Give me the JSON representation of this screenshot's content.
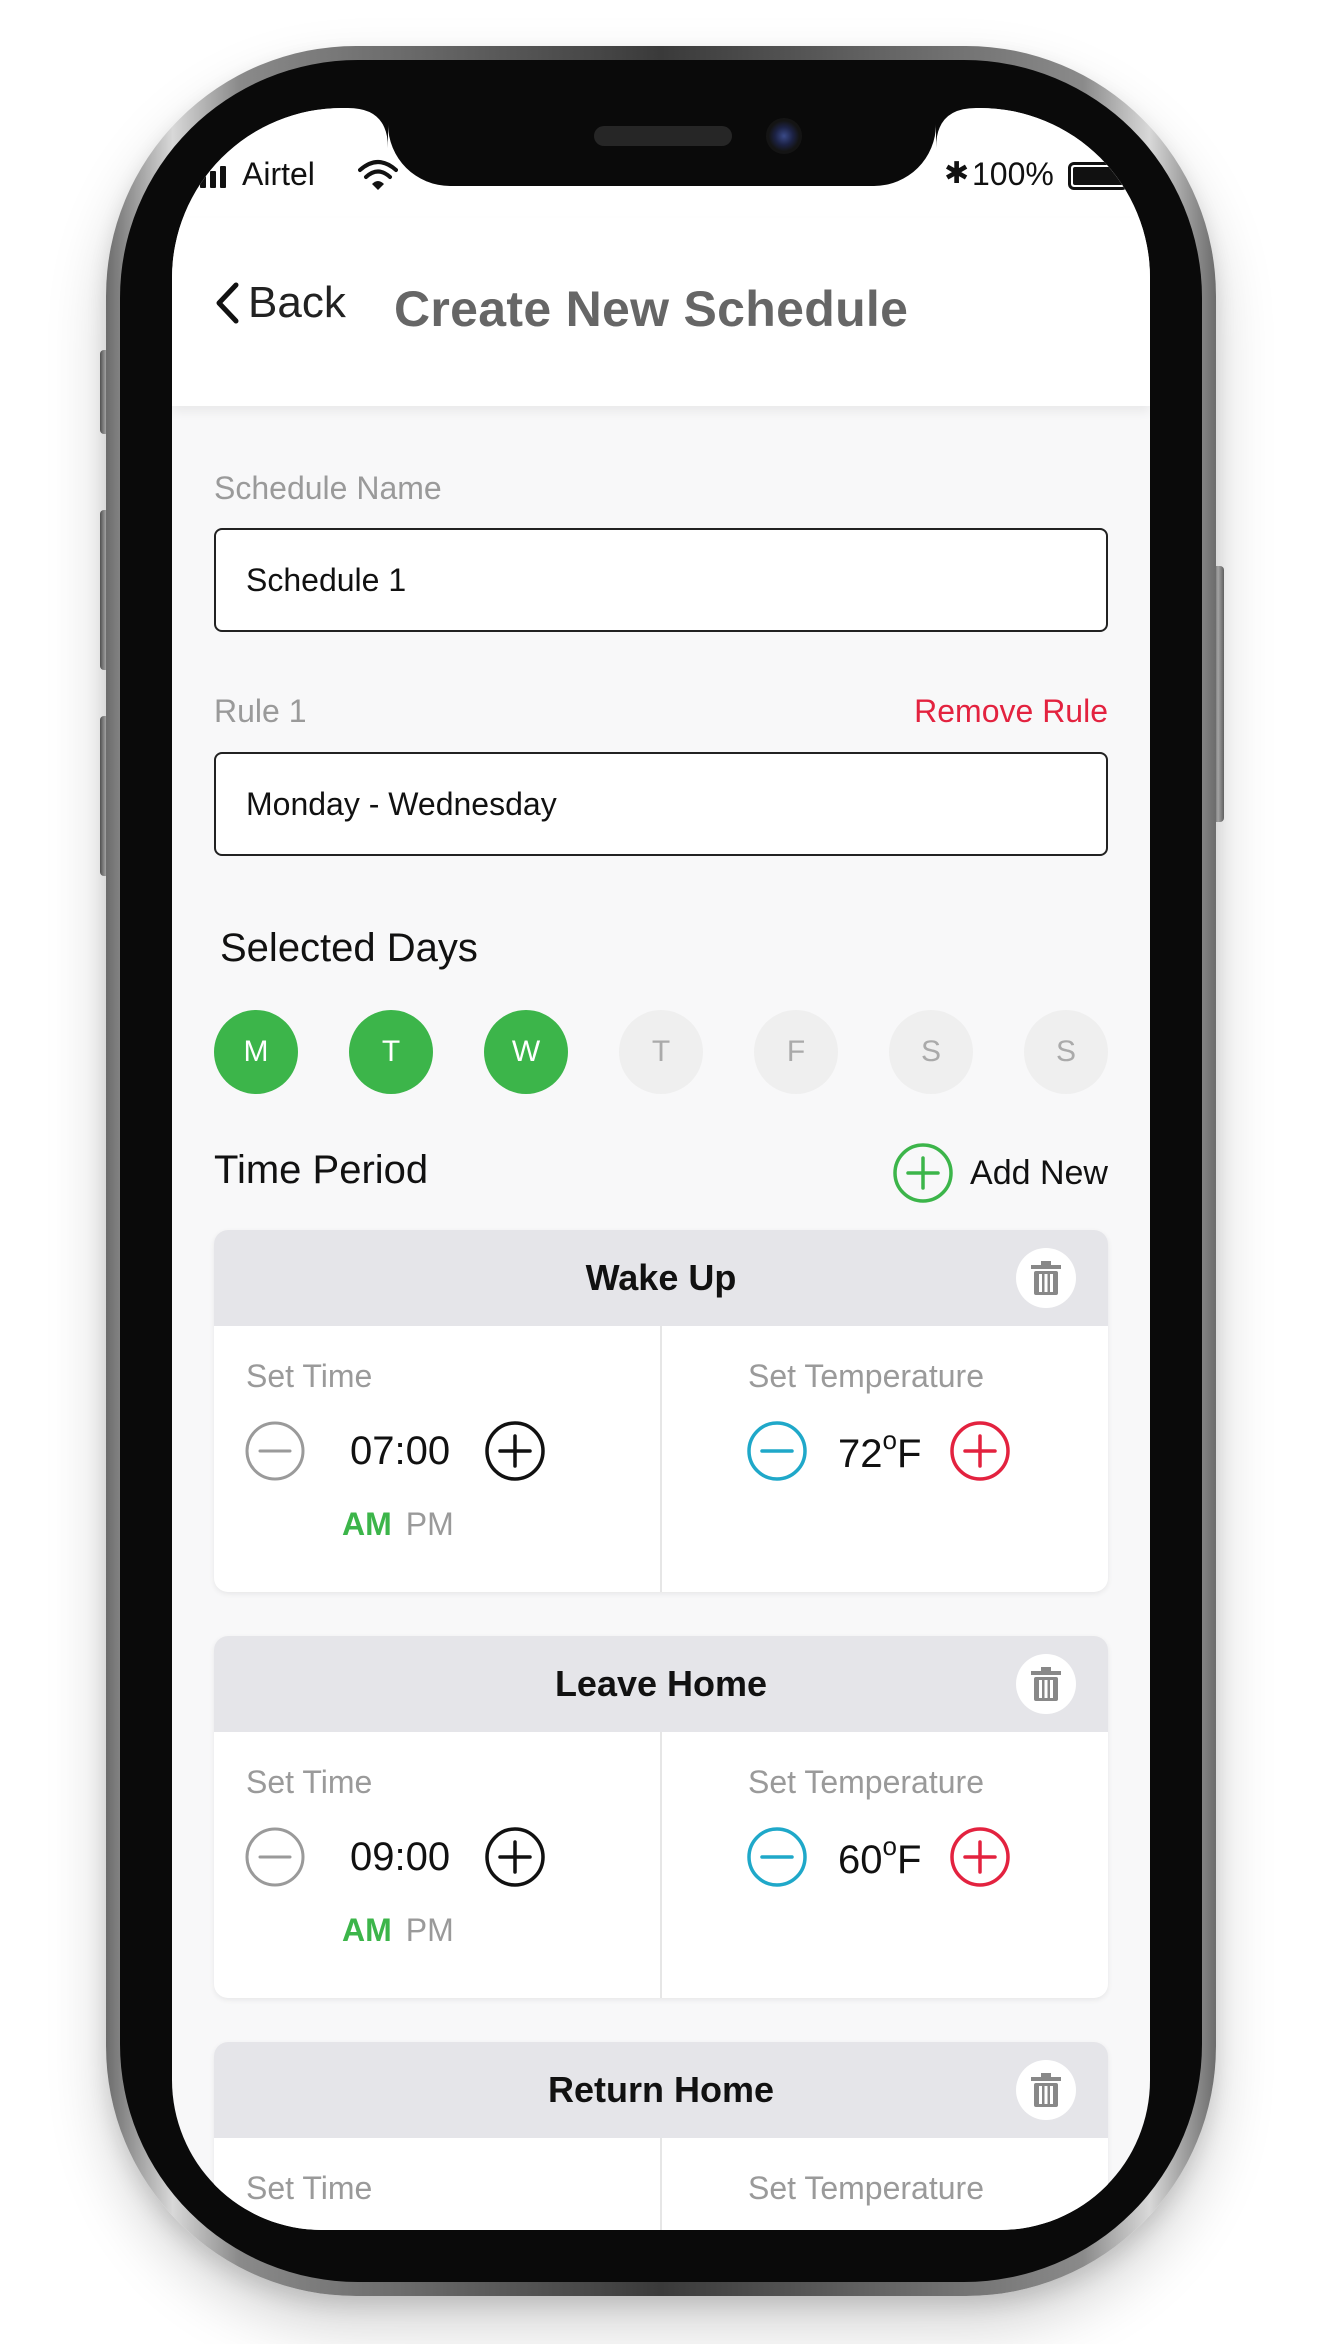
{
  "status_bar": {
    "carrier": "Airtel",
    "battery": "100%"
  },
  "header": {
    "back_label": "Back",
    "title": "Create New Schedule"
  },
  "schedule_name": {
    "label": "Schedule Name",
    "value": "Schedule 1"
  },
  "rule": {
    "label": "Rule 1",
    "remove_label": "Remove Rule",
    "value": "Monday - Wednesday"
  },
  "selected_days": {
    "title": "Selected Days",
    "days": [
      {
        "label": "M",
        "selected": true
      },
      {
        "label": "T",
        "selected": true
      },
      {
        "label": "W",
        "selected": true
      },
      {
        "label": "T",
        "selected": false
      },
      {
        "label": "F",
        "selected": false
      },
      {
        "label": "S",
        "selected": false
      },
      {
        "label": "S",
        "selected": false
      }
    ]
  },
  "time_period": {
    "title": "Time Period",
    "add_label": "Add New"
  },
  "periods": [
    {
      "name": "Wake Up",
      "time_label": "Set Time",
      "time": "07:00",
      "am": "AM",
      "pm": "PM",
      "temp_label": "Set Temperature",
      "temp": "72",
      "deg": "o",
      "unit": "F"
    },
    {
      "name": "Leave Home",
      "time_label": "Set Time",
      "time": "09:00",
      "am": "AM",
      "pm": "PM",
      "temp_label": "Set Temperature",
      "temp": "60",
      "deg": "o",
      "unit": "F"
    },
    {
      "name": "Return Home",
      "time_label": "Set Time",
      "temp_label": "Set Temperature"
    }
  ],
  "colors": {
    "accent_green": "#3cb54a",
    "danger_red": "#e3223f",
    "minus_teal": "#1fa8c9"
  }
}
